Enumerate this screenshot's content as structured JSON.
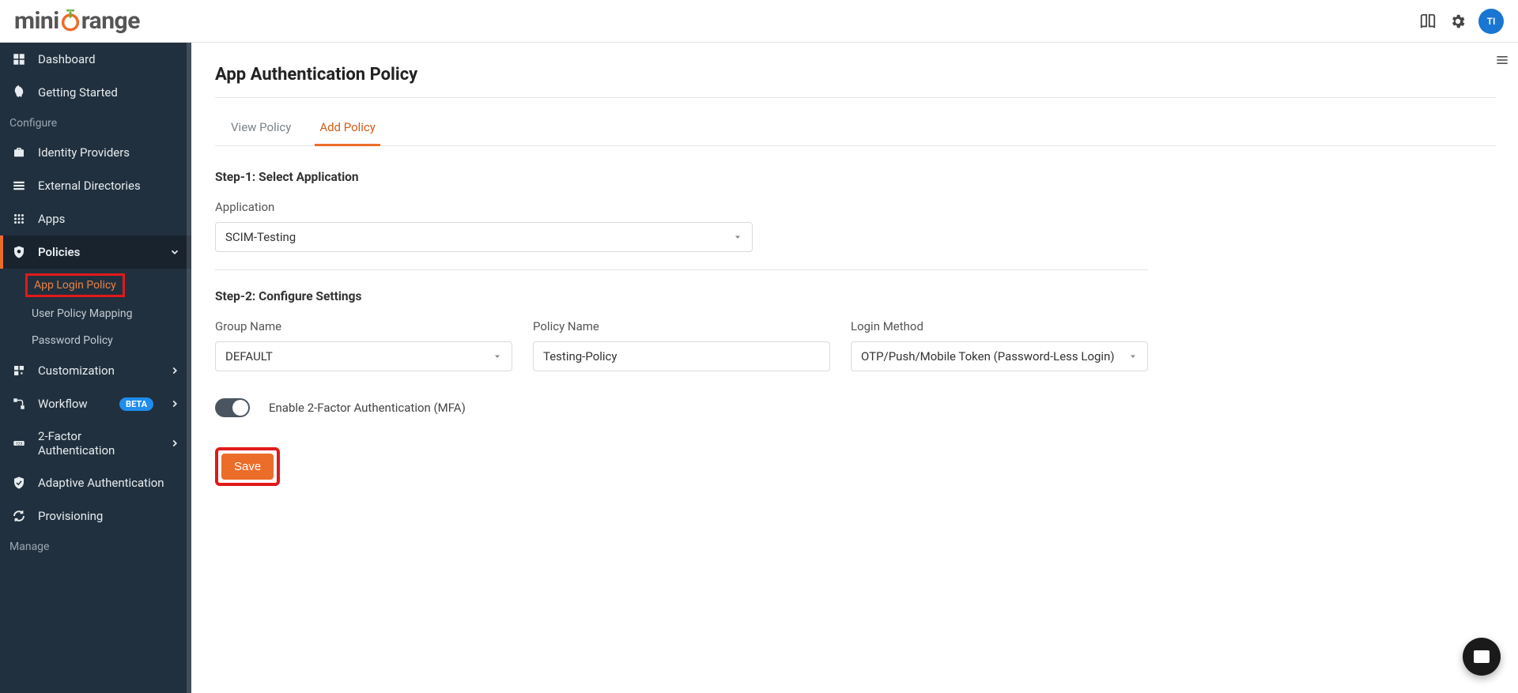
{
  "header": {
    "logo_text": "miniOrange",
    "avatar_initials": "TI"
  },
  "sidebar": {
    "items": [
      {
        "label": "Dashboard",
        "icon": "dashboard"
      },
      {
        "label": "Getting Started",
        "icon": "rocket"
      }
    ],
    "section1_label": "Configure",
    "configure_items": [
      {
        "label": "Identity Providers",
        "icon": "briefcase"
      },
      {
        "label": "External Directories",
        "icon": "list"
      },
      {
        "label": "Apps",
        "icon": "grid"
      },
      {
        "label": "Policies",
        "icon": "shield",
        "active": true
      },
      {
        "label": "Customization",
        "icon": "puzzle",
        "expandable": true
      },
      {
        "label": "Workflow",
        "icon": "workflow",
        "badge": "BETA",
        "expandable": true
      },
      {
        "label": "2-Factor Authentication",
        "icon": "pin",
        "expandable": true
      },
      {
        "label": "Adaptive Authentication",
        "icon": "check-shield"
      },
      {
        "label": "Provisioning",
        "icon": "sync"
      }
    ],
    "policies_sub": [
      {
        "label": "App Login Policy",
        "highlight": true
      },
      {
        "label": "User Policy Mapping"
      },
      {
        "label": "Password Policy"
      }
    ],
    "section2_label": "Manage"
  },
  "main": {
    "title": "App Authentication Policy",
    "tabs": [
      {
        "label": "View Policy",
        "active": false
      },
      {
        "label": "Add Policy",
        "active": true
      }
    ],
    "step1_label": "Step-1: Select Application",
    "application_label": "Application",
    "application_value": "SCIM-Testing",
    "step2_label": "Step-2: Configure Settings",
    "group_name_label": "Group Name",
    "group_name_value": "DEFAULT",
    "policy_name_label": "Policy Name",
    "policy_name_value": "Testing-Policy",
    "login_method_label": "Login Method",
    "login_method_value": "OTP/Push/Mobile Token (Password-Less Login)",
    "mfa_label": "Enable 2-Factor Authentication (MFA)",
    "save_label": "Save"
  }
}
